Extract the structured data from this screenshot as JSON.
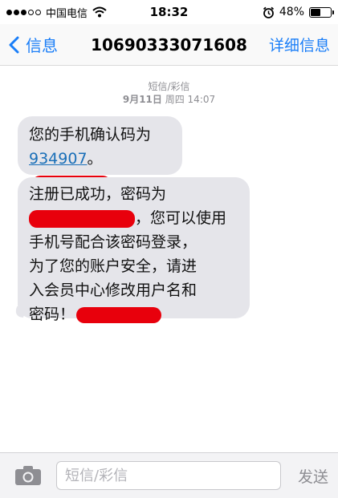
{
  "status_bar": {
    "carrier": "中国电信",
    "time": "18:32",
    "battery": "48%",
    "signal_bars_filled": 3,
    "signal_bars_total": 5
  },
  "nav": {
    "back_label": "信息",
    "title": "10690333071608",
    "details_label": "详细信息"
  },
  "conversation": {
    "header_type": "短信/彩信",
    "date": "9月11日",
    "weekday_time": "周四 14:07",
    "messages": [
      {
        "line1": "您的手机确认码为",
        "code": "934907",
        "after_code": "。"
      },
      {
        "line1": "注册已成功，密码为",
        "line2_suffix": "，您可以使用",
        "line3": "手机号配合该密码登录，",
        "line4": "为了您的账户安全，请进",
        "line5": "入会员中心修改用户名和",
        "line6": "密码！"
      }
    ]
  },
  "input_bar": {
    "camera_icon": "camera-icon",
    "placeholder": "短信/彩信",
    "send_label": "发送"
  },
  "colors": {
    "accent": "#1a7ef8",
    "bubble": "#e5e5ea",
    "redaction": "#e8000c",
    "timestamp": "#8e8e93"
  }
}
